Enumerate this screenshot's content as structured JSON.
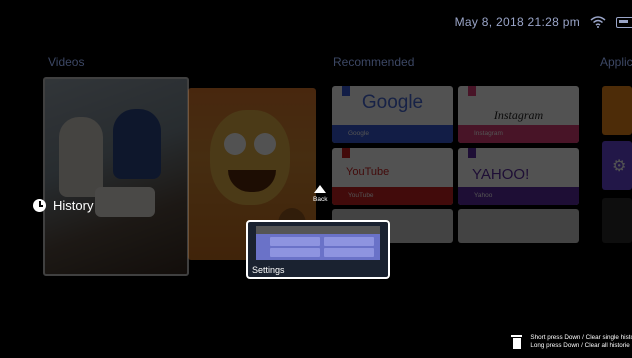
{
  "status_bar": {
    "datetime": "May 8, 2018  21:28 pm",
    "wifi_icon": "wifi-icon",
    "battery_icon": "battery-icon"
  },
  "sections": {
    "videos": "Videos",
    "recommended": "Recommended",
    "applications": "Applica"
  },
  "history_label": "History",
  "back_label": "Back",
  "recommended_tiles": [
    {
      "brand": "Google",
      "label": "Google",
      "accent": "#3a5bd8"
    },
    {
      "brand": "Instagram",
      "label": "Instagram",
      "accent": "#e0407a"
    },
    {
      "brand": "YouTube",
      "label": "YouTube",
      "accent": "#cc2222"
    },
    {
      "brand": "YAHOO!",
      "label": "Yahoo",
      "accent": "#5e2ca5"
    }
  ],
  "settings_tile": {
    "label": "Settings"
  },
  "hint": {
    "line1": "Short press Down / Clear single histo",
    "line2": "Long press Down / Clear all historie"
  }
}
